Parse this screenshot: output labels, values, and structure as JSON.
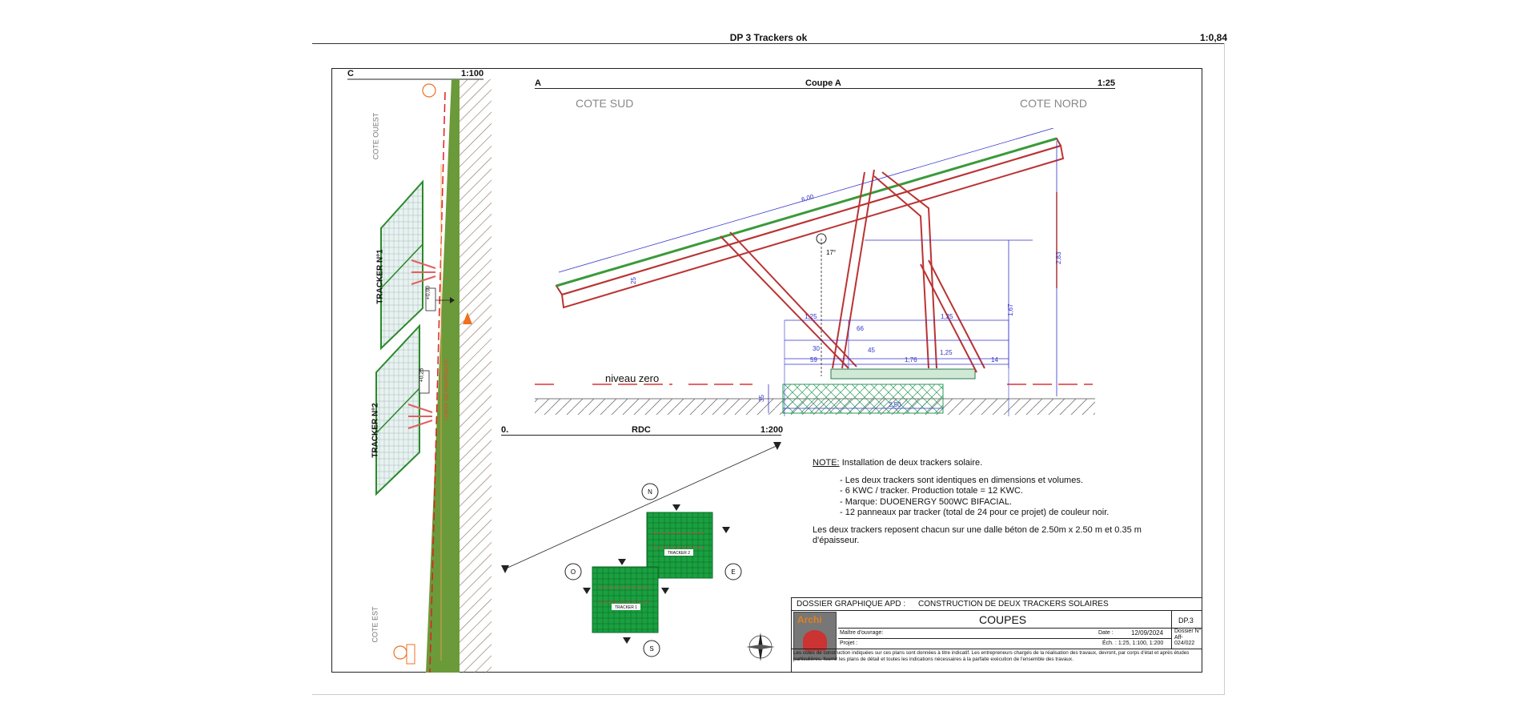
{
  "header": {
    "title": "DP 3 Trackers ok",
    "scale": "1:0,84"
  },
  "section_c": {
    "letter": "C",
    "scale": "1:100",
    "cote_ouest": "COTE OUEST",
    "cote_est": "COTE EST",
    "tracker1": "TRACKER N°1",
    "tracker2": "TRACKER N°2",
    "dim1": "+0,00",
    "dim2": "+0,25"
  },
  "coupe_a": {
    "letter": "A",
    "title": "Coupe A",
    "scale": "1:25",
    "cote_sud": "COTE SUD",
    "cote_nord": "COTE NORD",
    "niveau_zero": "niveau zero",
    "dims": {
      "length": "6,00",
      "angle": "17°",
      "height": "2,83",
      "h2": "1,67",
      "d125a": "1,25",
      "d125b": "1,25",
      "d125c": "1,25",
      "d66": "66",
      "d45": "45",
      "d59": "59",
      "d176": "1,76",
      "d14": "14",
      "d30": "30",
      "d250": "2,50",
      "d35": "35",
      "d25": "25"
    }
  },
  "rdc": {
    "letter": "0.",
    "title": "RDC",
    "scale": "1:200",
    "tracker1": "TRACKER 1",
    "tracker2": "TRACKER 2",
    "compass": {
      "n": "N",
      "o": "O",
      "e": "E",
      "s": "S"
    }
  },
  "note": {
    "label": "NOTE:",
    "intro": "Installation de deux trackers solaire.",
    "items": [
      "Les deux trackers sont identiques en dimensions et volumes.",
      "6 KWC / tracker. Production totale = 12 KWC.",
      "Marque: DUOENERGY 500WC BIFACIAL.",
      "12 panneaux par tracker (total de 24 pour ce projet) de couleur noir."
    ],
    "footer": "Les deux trackers reposent chacun sur une dalle béton de 2.50m x 2.50 m et 0.35 m d'épaisseur."
  },
  "title_block": {
    "dossier": "DOSSIER GRAPHIQUE APD :",
    "construction": "CONSTRUCTION DE DEUX TRACKERS SOLAIRES",
    "logo": "Archi",
    "coupes": "COUPES",
    "sheet": "DP.3",
    "maitre": "Maître d'ouvrage:",
    "date_label": "Date :",
    "date": "12/09/2024",
    "dossier_no_label": "Dossier N°",
    "dossier_no": "Aff-024/022",
    "projet": "Projet :",
    "ech": "Éch. : 1:25, 1:100, 1:200",
    "disclaimer": "Les cotes de construction indiquées sur ces plans sont données à titre indicatif. Les entrepreneurs chargés de la réalisation des travaux, devront, par corps d'état et après études particulières, fournir les plans de détail et toutes les indications nécessaires à la parfaite exécution de l'ensemble des travaux."
  }
}
